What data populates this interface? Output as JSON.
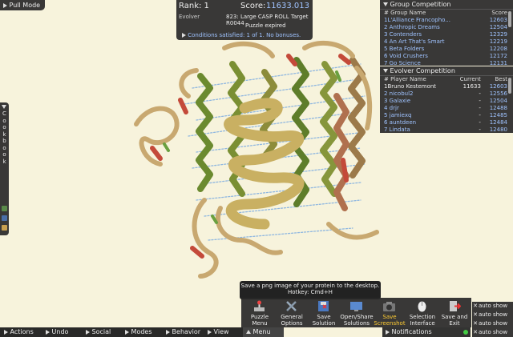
{
  "pull_mode": "Pull Mode",
  "score_panel": {
    "rank_label": "Rank: 1",
    "score_label": "Score:",
    "score_value": "11633.013",
    "evolver": "Evolver",
    "puzzle": "823: Large CASP ROLL Target R0044",
    "status": "Puzzle expired",
    "conditions": "Conditions satisfied: 1 of 1. No bonuses."
  },
  "group_competition": {
    "title": "Group Competition",
    "col_name": "# Group Name",
    "col_score": "Score",
    "rows": [
      {
        "name": "1L'Alliance Francopho...",
        "score": "12603"
      },
      {
        "name": "2 Anthropic Dreams",
        "score": "12504"
      },
      {
        "name": "3 Contenders",
        "score": "12329"
      },
      {
        "name": "4  An Art That's Smart",
        "score": "12219"
      },
      {
        "name": "5 Beta Folders",
        "score": "12208"
      },
      {
        "name": "6 Void Crushers",
        "score": "12172"
      },
      {
        "name": "7 Go Science",
        "score": "12131"
      }
    ]
  },
  "evolver_competition": {
    "title": "Evolver Competition",
    "col_name": "# Player Name",
    "col_current": "Current",
    "col_best": "Best",
    "rows": [
      {
        "name": "1Bruno Kestemont",
        "current": "11633",
        "best": "12603"
      },
      {
        "name": "2 nicobul2",
        "current": "-",
        "best": "12556"
      },
      {
        "name": "3 Galaxie",
        "current": "-",
        "best": "12504"
      },
      {
        "name": "4 drjr",
        "current": "-",
        "best": "12488"
      },
      {
        "name": "5 jamiexq",
        "current": "-",
        "best": "12485"
      },
      {
        "name": "6 auntdeen",
        "current": "-",
        "best": "12484"
      },
      {
        "name": "7 Lindata",
        "current": "-",
        "best": "12480"
      }
    ]
  },
  "cookbook_letters": [
    "C",
    "o",
    "o",
    "k",
    "b",
    "o",
    "o",
    "k"
  ],
  "bottom_bar": [
    "Actions",
    "Undo",
    "Social",
    "Modes",
    "Behavior",
    "View",
    "Menu"
  ],
  "tooltip": {
    "line1": "Save a png image of your protein to the desktop.",
    "line2": "Hotkey: Cmd+H"
  },
  "menu_buttons": [
    {
      "label1": "Puzzle",
      "label2": "Menu"
    },
    {
      "label1": "General",
      "label2": "Options"
    },
    {
      "label1": "Save",
      "label2": "Solution"
    },
    {
      "label1": "Open/Share",
      "label2": "Solutions"
    },
    {
      "label1": "Save",
      "label2": "Screenshot"
    },
    {
      "label1": "Selection",
      "label2": "Interface"
    },
    {
      "label1": "Save and",
      "label2": "Exit"
    }
  ],
  "notifications": "Notifications",
  "auto_show": [
    "auto show",
    "auto show",
    "auto show",
    "auto show"
  ],
  "colors": {
    "accent": "#9fc3ff",
    "highlight": "#ffcc33",
    "background": "#f7f3dc"
  }
}
